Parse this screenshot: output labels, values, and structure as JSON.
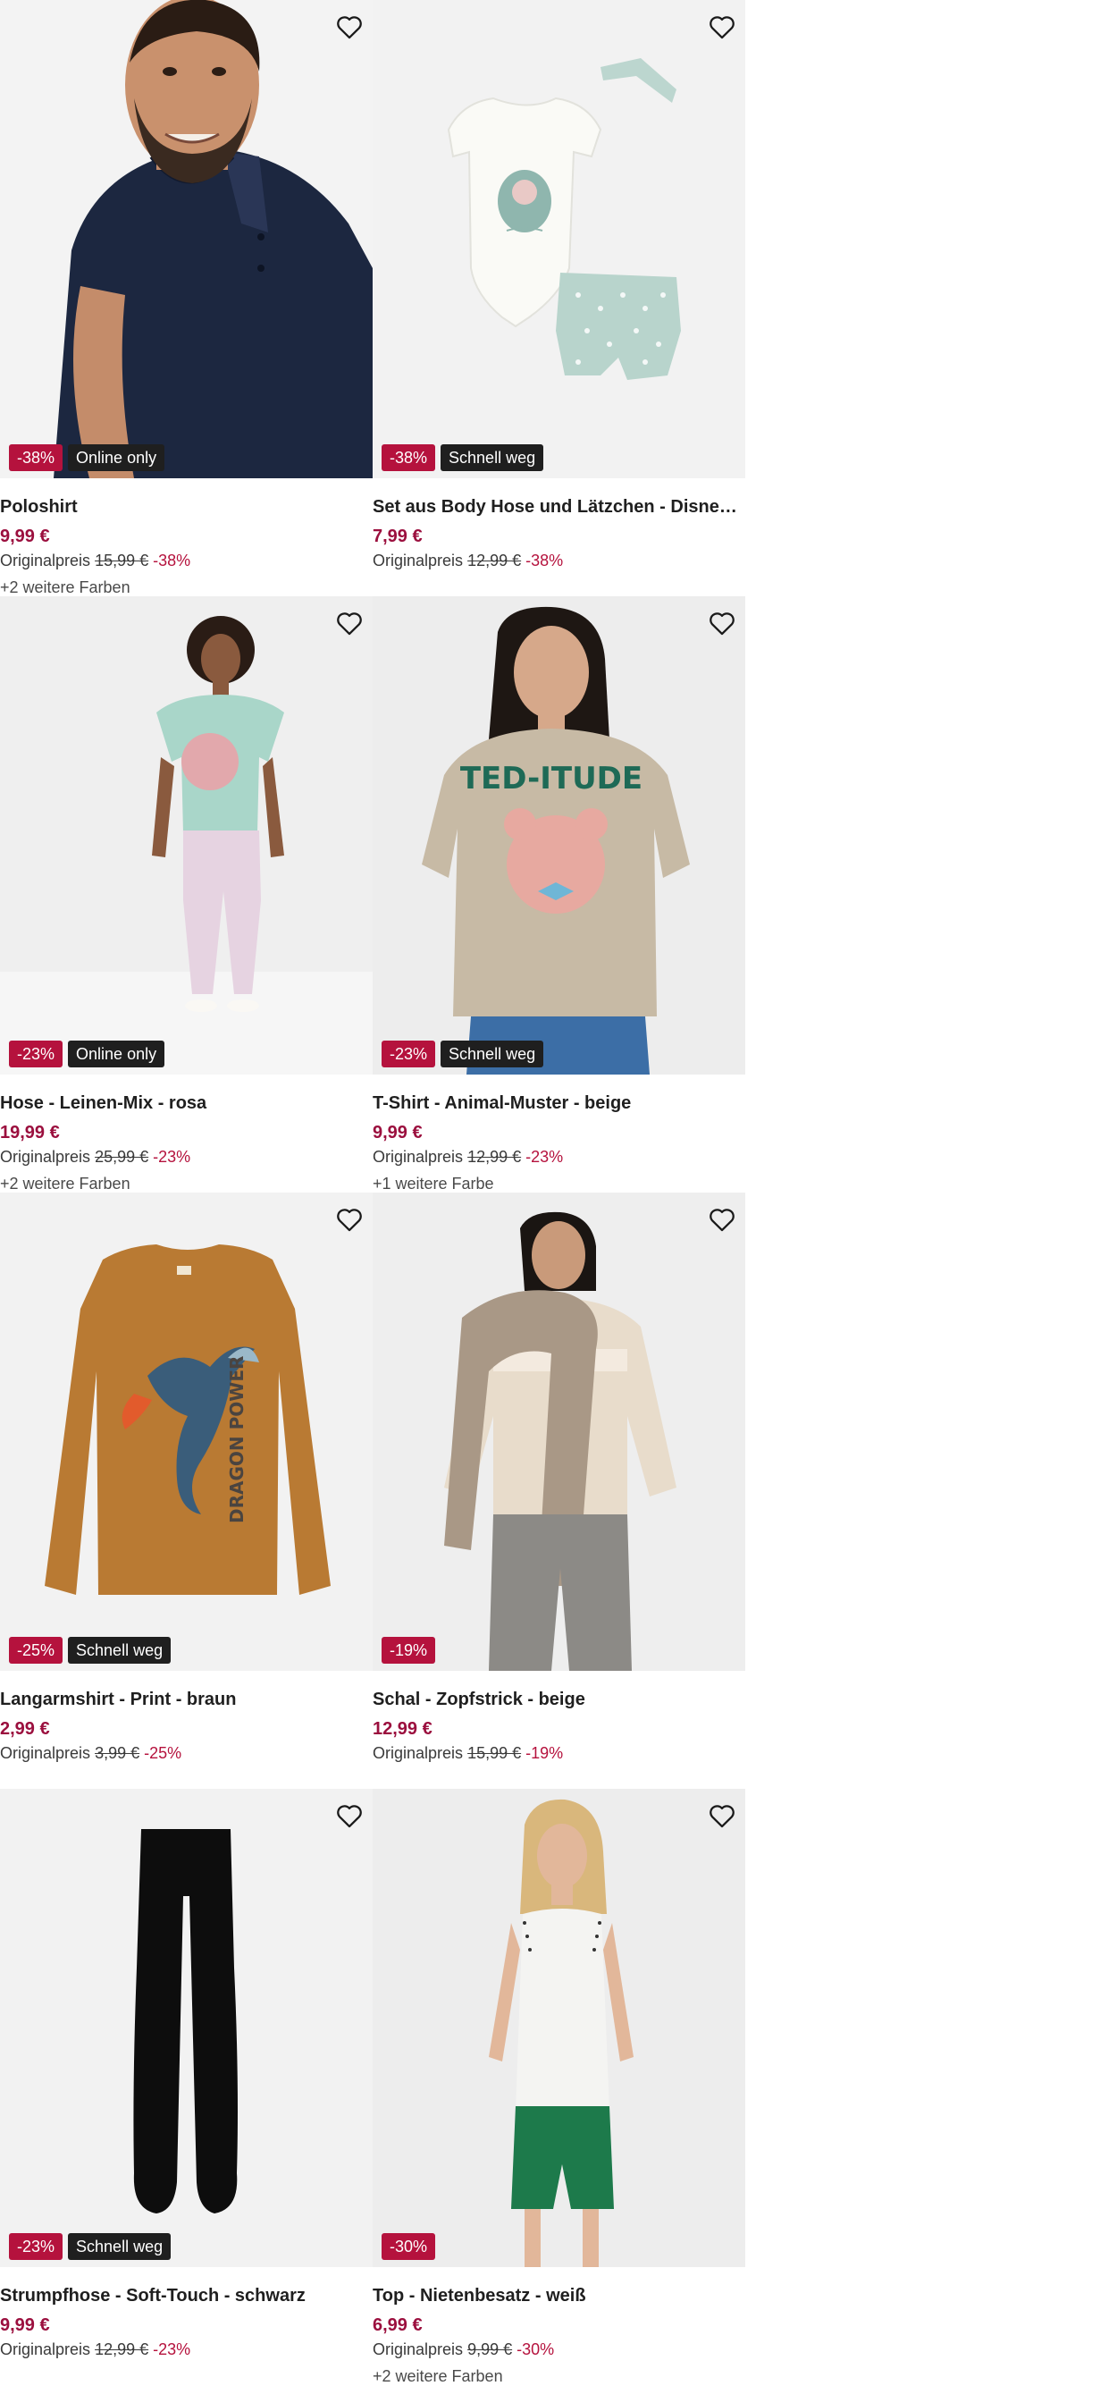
{
  "colors": {
    "price": "#9b0f3e",
    "discount_badge": "#b5123d",
    "label_badge": "#1f1f1f",
    "image_bg": "#f1f1f1"
  },
  "products": [
    {
      "title": "Poloshirt",
      "price": "9,99 €",
      "original_label": "Originalpreis",
      "original_price": "15,99 €",
      "discount": "-38%",
      "badge": "Online only",
      "extra_colors": "+2 weitere Farben",
      "image": "man-navy-polo",
      "image_bg": "#f3f3f3"
    },
    {
      "title": "Set aus Body Hose und Lätzchen - Disney - ...",
      "price": "7,99 €",
      "original_label": "Originalpreis",
      "original_price": "12,99 €",
      "discount": "-38%",
      "badge": "Schnell weg",
      "extra_colors": "",
      "image": "baby-set",
      "image_bg": "#f2f2f2"
    },
    {
      "title": "Hose - Leinen-Mix - rosa",
      "price": "19,99 €",
      "original_label": "Originalpreis",
      "original_price": "25,99 €",
      "discount": "-23%",
      "badge": "Online only",
      "extra_colors": "+2 weitere Farben",
      "image": "woman-pink-trousers",
      "image_bg": "#efefef"
    },
    {
      "title": "T-Shirt - Animal-Muster - beige",
      "price": "9,99 €",
      "original_label": "Originalpreis",
      "original_price": "12,99 €",
      "discount": "-23%",
      "badge": "Schnell weg",
      "extra_colors": "+1 weitere Farbe",
      "image": "woman-beige-tshirt",
      "image_bg": "#ededed"
    },
    {
      "title": "Langarmshirt - Print - braun",
      "price": "2,99 €",
      "original_label": "Originalpreis",
      "original_price": "3,99 €",
      "discount": "-25%",
      "badge": "Schnell weg",
      "extra_colors": "",
      "image": "brown-longsleeve",
      "image_bg": "#f2f2f2"
    },
    {
      "title": "Schal - Zopfstrick - beige",
      "price": "12,99 €",
      "original_label": "Originalpreis",
      "original_price": "15,99 €",
      "discount": "-19%",
      "badge": "",
      "extra_colors": "",
      "image": "woman-scarf",
      "image_bg": "#eeeeee"
    },
    {
      "title": "Strumpfhose - Soft-Touch - schwarz",
      "price": "9,99 €",
      "original_label": "Originalpreis",
      "original_price": "12,99 €",
      "discount": "-23%",
      "badge": "Schnell weg",
      "extra_colors": "",
      "image": "black-tights",
      "image_bg": "#f2f2f2"
    },
    {
      "title": "Top - Nietenbesatz - weiß",
      "price": "6,99 €",
      "original_label": "Originalpreis",
      "original_price": "9,99 €",
      "discount": "-30%",
      "badge": "",
      "extra_colors": "+2 weitere Farben",
      "image": "woman-white-top",
      "image_bg": "#ededed"
    }
  ]
}
